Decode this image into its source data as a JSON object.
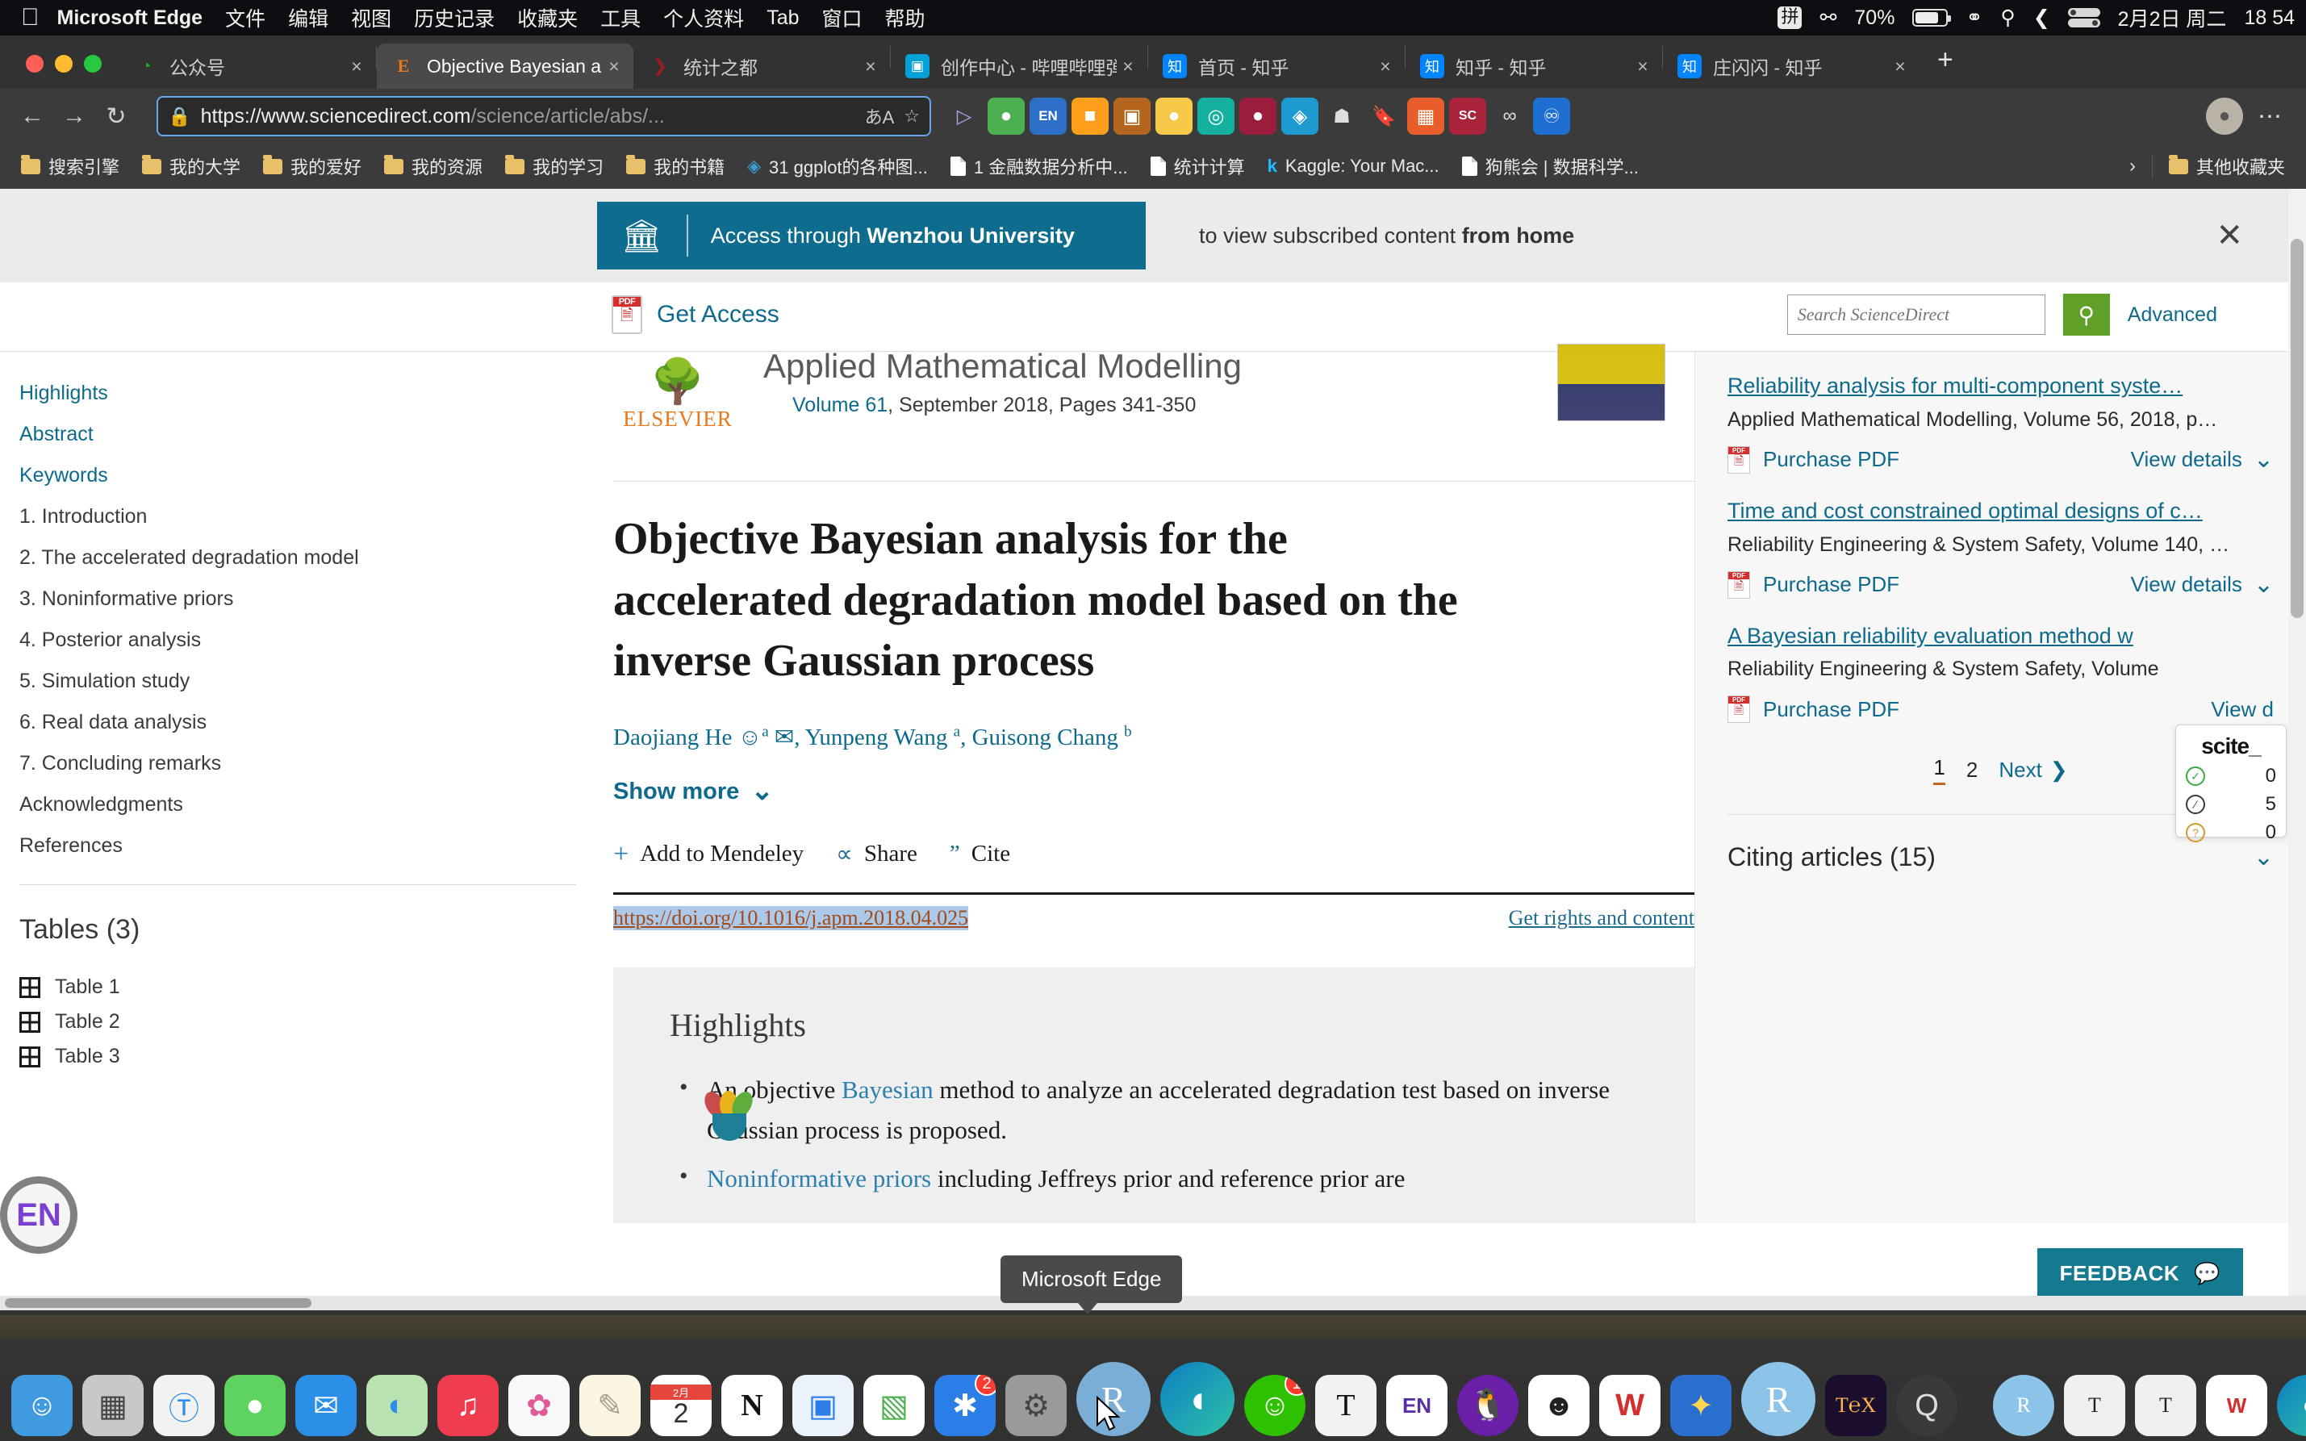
{
  "menubar": {
    "apple": "",
    "items": [
      "Microsoft Edge",
      "文件",
      "编辑",
      "视图",
      "历史记录",
      "收藏夹",
      "工具",
      "个人资料",
      "Tab",
      "窗口",
      "帮助"
    ],
    "ime": "拼",
    "battery_percent": "70%",
    "date": "2月2日 周二",
    "time": "18 54"
  },
  "browser": {
    "tabs": [
      {
        "title": "公众号",
        "favicon": "◔",
        "favicon_color": "#1aad19",
        "active": false,
        "close": "×"
      },
      {
        "title": "Objective Bayesian a",
        "favicon": "E",
        "favicon_color": "#e8791c",
        "active": true,
        "close": "×"
      },
      {
        "title": "统计之都",
        "favicon": "❯",
        "favicon_color": "#9b1c22",
        "active": false,
        "close": "×"
      },
      {
        "title": "创作中心 - 哔哩哔哩弹",
        "favicon": "▣",
        "favicon_color": "#00a1d6",
        "active": false,
        "close": "×"
      },
      {
        "title": "首页 - 知乎",
        "favicon": "知",
        "favicon_color": "#0084ff",
        "active": false,
        "close": "×"
      },
      {
        "title": "知乎 - 知乎",
        "favicon": "知",
        "favicon_color": "#0084ff",
        "active": false,
        "close": "×"
      },
      {
        "title": "庄闪闪 - 知乎",
        "favicon": "知",
        "favicon_color": "#0084ff",
        "active": false,
        "close": "×"
      }
    ],
    "newtab_label": "+",
    "nav": {
      "back": "←",
      "forward": "→",
      "reload": "↻"
    },
    "url_secure": "https",
    "url_host": "://www.sciencedirect.com",
    "url_path": "/science/article/abs/...",
    "url_translate_icon": "translate-icon",
    "url_favorite_icon": "☆",
    "bookmarks": [
      {
        "label": "搜索引擎",
        "type": "folder"
      },
      {
        "label": "我的大学",
        "type": "folder"
      },
      {
        "label": "我的爱好",
        "type": "folder"
      },
      {
        "label": "我的资源",
        "type": "folder"
      },
      {
        "label": "我的学习",
        "type": "folder"
      },
      {
        "label": "我的书籍",
        "type": "folder"
      },
      {
        "label": "31 ggplot的各种图...",
        "type": "diamond"
      },
      {
        "label": "1 金融数据分析中...",
        "type": "page"
      },
      {
        "label": "统计计算",
        "type": "page"
      },
      {
        "label": "Kaggle: Your Mac...",
        "type": "kaggle"
      },
      {
        "label": "狗熊会 | 数据科学...",
        "type": "page"
      }
    ],
    "bookmarks_overflow": "›",
    "other_bookmarks": "其他收藏夹"
  },
  "banner": {
    "icon": "bank-icon",
    "text_prefix": "Access through ",
    "institution": "Wenzhou University",
    "right_prefix": "to view subscribed content ",
    "right_bold": "from home",
    "close": "✕"
  },
  "sd_header": {
    "get_access": "Get Access",
    "search_placeholder": "Search ScienceDirect",
    "search_value": "",
    "advanced": "Advanced"
  },
  "toc": {
    "items": [
      {
        "label": "Highlights",
        "link": true
      },
      {
        "label": "Abstract",
        "link": true
      },
      {
        "label": "Keywords",
        "link": true
      },
      {
        "label": "1. Introduction",
        "link": false
      },
      {
        "label": "2. The accelerated degradation model",
        "link": false
      },
      {
        "label": "3. Noninformative priors",
        "link": false
      },
      {
        "label": "4. Posterior analysis",
        "link": false
      },
      {
        "label": "5. Simulation study",
        "link": false
      },
      {
        "label": "6. Real data analysis",
        "link": false
      },
      {
        "label": "7. Concluding remarks",
        "link": false
      },
      {
        "label": "Acknowledgments",
        "link": false
      },
      {
        "label": "References",
        "link": false
      }
    ],
    "tables_title": "Tables (3)",
    "tables": [
      "Table 1",
      "Table 2",
      "Table 3"
    ]
  },
  "article": {
    "publisher": "ELSEVIER",
    "journal": "Applied Mathematical Modelling",
    "volume": "Volume 61",
    "issue_info": ", September 2018, Pages 341-350",
    "title": "Objective Bayesian analysis for the accelerated degradation model based on the inverse Gaussian process",
    "authors_1": "Daojiang He",
    "authors_sup1": "a",
    "authors_2": ", Yunpeng Wang ",
    "authors_sup2": "a",
    "authors_3": ", Guisong Chang ",
    "authors_sup3": "b",
    "show_more": "Show more",
    "show_more_chevron": "⌄",
    "add_to_mendeley": "Add to Mendeley",
    "share": "Share",
    "cite": "Cite",
    "doi": "https://doi.org/10.1016/j.apm.2018.04.025",
    "rights": "Get rights and content"
  },
  "highlights": {
    "title": "Highlights",
    "bullets": [
      {
        "pre": "An objective ",
        "link": "Bayesian",
        "post": " method to analyze an accelerated degradation test based on inverse Gaussian process is proposed."
      },
      {
        "pre": "",
        "link": "Noninformative priors",
        "post": " including Jeffreys prior and reference prior are"
      }
    ]
  },
  "recommended": [
    {
      "title": "Reliability analysis for multi-component syste…",
      "source": "Applied Mathematical Modelling, Volume 56, 2018, p…",
      "purchase": "Purchase PDF",
      "view_details": "View details",
      "chevron": "⌄"
    },
    {
      "title": "Time and cost constrained optimal designs of c…",
      "source": "Reliability Engineering & System Safety, Volume 140, …",
      "purchase": "Purchase PDF",
      "view_details": "View details",
      "chevron": "⌄"
    },
    {
      "title": "A Bayesian reliability evaluation method w",
      "source": "Reliability Engineering & System Safety, Volume",
      "purchase": "Purchase PDF",
      "view_details": "View d",
      "chevron": "⌄"
    }
  ],
  "pager": {
    "page1": "1",
    "page2": "2",
    "next": "Next",
    "next_chevron": "❯"
  },
  "citing": {
    "label": "Citing articles (15)",
    "chevron": "⌄"
  },
  "scite": {
    "logo": "scite_",
    "supporting": "0",
    "contrasting": "5",
    "mentioning": "0"
  },
  "feedback": {
    "label": "FEEDBACK",
    "icon": "speech-bubble-icon"
  },
  "tooltip": {
    "text": "Microsoft Edge"
  },
  "ime_float": {
    "label": "EN"
  },
  "dock": {
    "items": [
      {
        "name": "finder",
        "glyph": "☺",
        "bg": "#3f9ae0",
        "running": false
      },
      {
        "name": "launchpad",
        "glyph": "☷",
        "bg": "#c8c8c8",
        "running": false
      },
      {
        "name": "safari",
        "glyph": "◉",
        "bg": "#f2f2f2",
        "running": false
      },
      {
        "name": "messages",
        "glyph": "●",
        "bg": "#5fd35f",
        "running": false
      },
      {
        "name": "mail",
        "glyph": "✉",
        "bg": "#2b8fe8",
        "running": false
      },
      {
        "name": "maps",
        "glyph": "△",
        "bg": "#b9e3b0",
        "running": true
      },
      {
        "name": "music",
        "glyph": "♫",
        "bg": "#ef3c4e",
        "running": false
      },
      {
        "name": "photos",
        "glyph": "✿",
        "bg": "#f4f4f4",
        "running": false
      },
      {
        "name": "notes",
        "glyph": "✎",
        "bg": "#fbf5e3",
        "running": false
      },
      {
        "name": "calendar",
        "glyph": "2",
        "bg": "#ffffff",
        "running": false
      },
      {
        "name": "notion",
        "glyph": "N",
        "bg": "#ffffff",
        "running": true
      },
      {
        "name": "keynote",
        "glyph": "▣",
        "bg": "#e8f0fb",
        "running": false
      },
      {
        "name": "numbers",
        "glyph": "▐",
        "bg": "#ffffff",
        "running": false
      },
      {
        "name": "app-store",
        "glyph": "A",
        "bg": "#2b7ee8",
        "running": false,
        "badge": "2"
      },
      {
        "name": "system-preferences",
        "glyph": "⚙",
        "bg": "#9a9a9a",
        "running": false
      },
      {
        "name": "rstudio",
        "glyph": "R",
        "bg": "#7aaed6",
        "running": false
      },
      {
        "name": "microsoft-edge",
        "glyph": "◖",
        "bg": "#1d9bd1",
        "running": true
      },
      {
        "name": "wechat",
        "glyph": "●●",
        "bg": "#2dc100",
        "running": true,
        "badge": "1"
      },
      {
        "name": "texshop",
        "glyph": "T",
        "bg": "#f2f2f2",
        "running": true
      },
      {
        "name": "endnote",
        "glyph": "EN",
        "bg": "#ffffff",
        "running": false
      },
      {
        "name": "github",
        "glyph": "●",
        "bg": "#6b1fa8",
        "running": false
      },
      {
        "name": "xmind",
        "glyph": "☻",
        "bg": "#ffffff",
        "running": true
      },
      {
        "name": "wps",
        "glyph": "W",
        "bg": "#ffffff",
        "running": false
      },
      {
        "name": "ccleaner",
        "glyph": "✦",
        "bg": "#2a6fd0",
        "running": false
      },
      {
        "name": "r-daily2021",
        "glyph": "R",
        "bg": "#8cc3e8",
        "running": true
      },
      {
        "name": "latex",
        "glyph": "TₑX",
        "bg": "#1a0d2e",
        "running": true
      },
      {
        "name": "quicktime",
        "glyph": "Q",
        "bg": "#3a3a3a",
        "running": true
      }
    ],
    "minimized": [
      {
        "name": "rstudio-window",
        "glyph": "R"
      },
      {
        "name": "tex-window-1",
        "glyph": "T"
      },
      {
        "name": "tex-window-2",
        "glyph": "T"
      },
      {
        "name": "wps-window",
        "glyph": "W"
      },
      {
        "name": "edge-window-1",
        "glyph": "◖"
      },
      {
        "name": "doc-window",
        "glyph": "☰"
      },
      {
        "name": "edge-window-2",
        "glyph": "◖"
      },
      {
        "name": "trash",
        "glyph": "Ὕ1"
      }
    ]
  }
}
